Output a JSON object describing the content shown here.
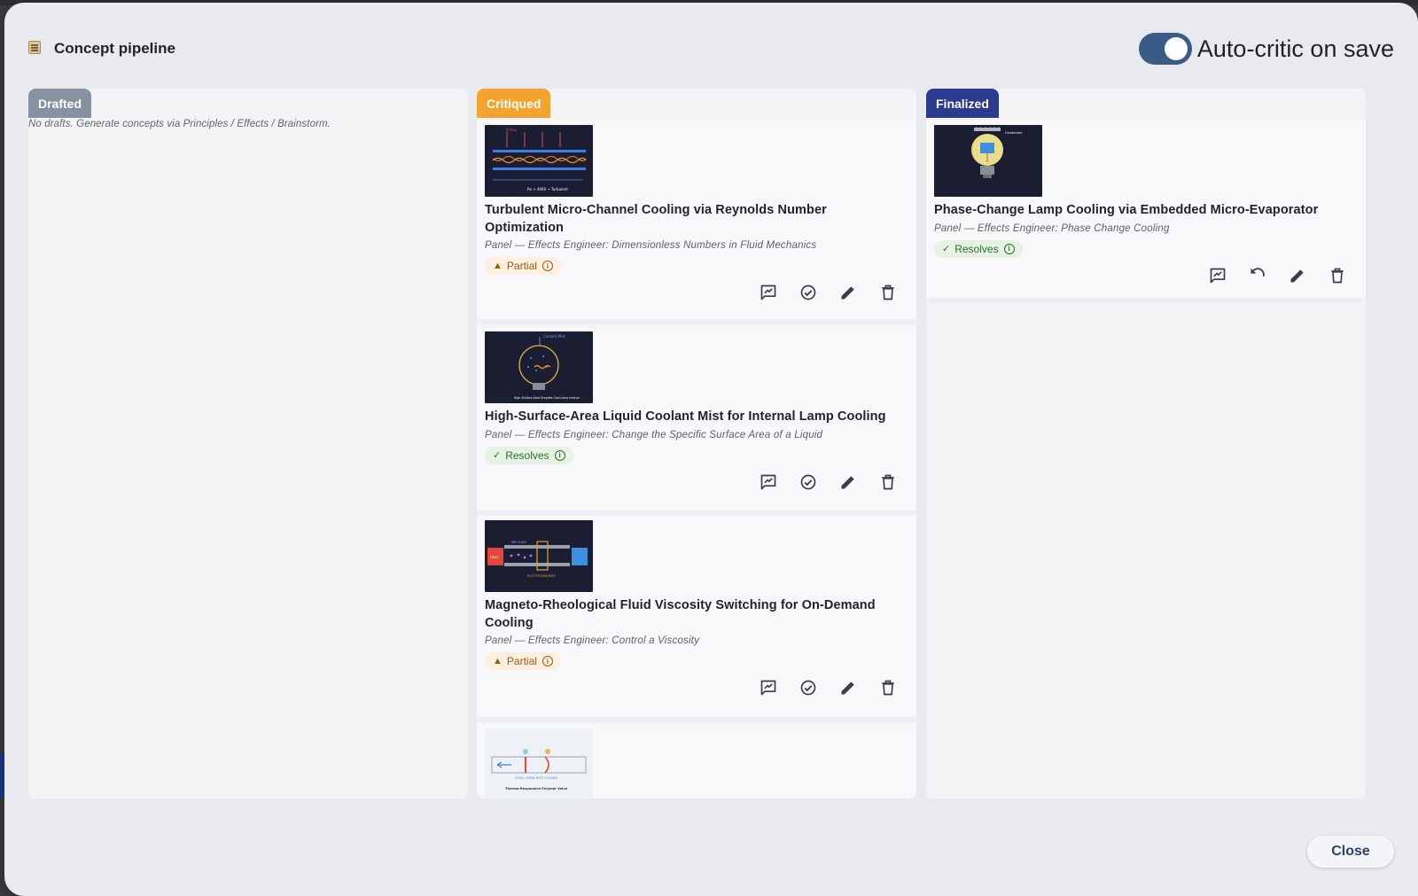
{
  "modal": {
    "title": "Concept pipeline",
    "toggle_label": "Auto-critic on save",
    "toggle_on": true,
    "close_label": "Close"
  },
  "columns": {
    "drafted": {
      "label": "Drafted",
      "empty_text": "No drafts. Generate concepts via Principles / Effects / Brainstorm."
    },
    "critiqued": {
      "label": "Critiqued",
      "cards": [
        {
          "title": "Turbulent Micro-Channel Cooling via Reynolds Number Optimization",
          "subtitle": "Panel — Effects Engineer: Dimensionless Numbers in Fluid Mechanics",
          "status": "Partial",
          "thumb_caption": "Re > 4000 → Turbulent",
          "thumb_label": "Q flux"
        },
        {
          "title": "High-Surface-Area Liquid Coolant Mist for Internal Lamp Cooling",
          "subtitle": "Panel — Effects Engineer: Change the Specific Surface Area of a Liquid",
          "status": "Resolves",
          "thumb_caption": "High-Surface-Area Droplets Cool Lamp Interior",
          "thumb_label": "Coolant Mist"
        },
        {
          "title": "Magneto-Rheological Fluid Viscosity Switching for On-Demand Cooling",
          "subtitle": "Panel — Effects Engineer: Control a Viscosity",
          "status": "Partial",
          "thumb_caption": "ELECTROMAGNET",
          "thumb_label": "MR FLUID",
          "thumb_heat": "HEAT"
        },
        {
          "thumb_caption": "Thermo-Responsive Polymer Valve",
          "thumb_label": "COOL: OPEN  HOT: CLOSED"
        }
      ]
    },
    "finalized": {
      "label": "Finalized",
      "cards": [
        {
          "title": "Phase-Change Lamp Cooling via Embedded Micro-Evaporator",
          "subtitle": "Panel — Effects Engineer: Phase Change Cooling",
          "status": "Resolves",
          "thumb_label": "Condenser"
        }
      ]
    }
  },
  "icons": {
    "critique": "critique-icon",
    "approve": "check-circle-icon",
    "edit": "pencil-icon",
    "delete": "trash-icon",
    "undo": "undo-icon",
    "info": "info-icon"
  },
  "colors": {
    "drafted_tag": "#8592a1",
    "critiqued_tag": "#f2a42f",
    "finalized_tag": "#2c3a8f",
    "toggle": "#3b5a85"
  }
}
